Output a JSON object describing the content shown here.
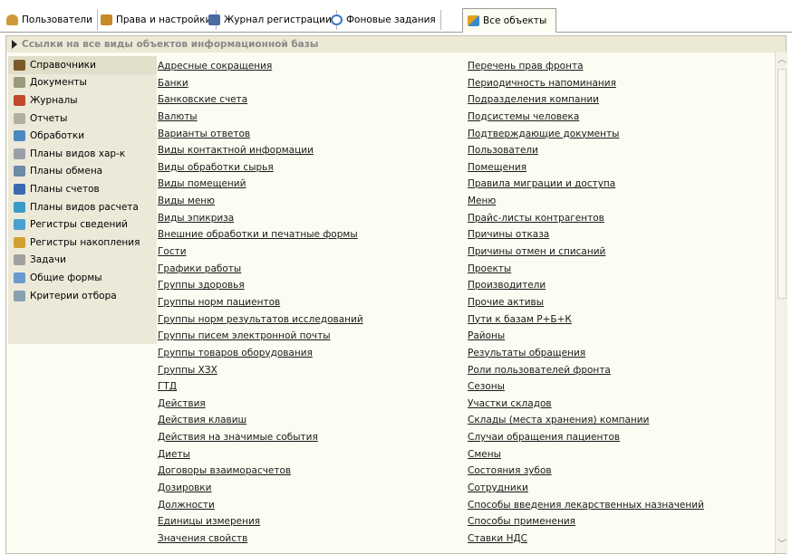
{
  "tabs": [
    {
      "label": "Пользователи",
      "icon": "users-icon",
      "color": "#d09a3a"
    },
    {
      "label": "Права и настройки",
      "icon": "permissions-icon",
      "color": "#c98a2a"
    },
    {
      "label": "Журнал регистрации",
      "icon": "log-icon",
      "color": "#4a6aa0"
    },
    {
      "label": "Фоновые задания",
      "icon": "clock-icon",
      "color": "#3a74c8"
    },
    {
      "label": "Все объекты",
      "icon": "objects-icon",
      "color": "#e3a21a"
    }
  ],
  "section": {
    "title": "Ссылки на все виды объектов информационной базы"
  },
  "sidebar": {
    "items": [
      {
        "label": "Справочники",
        "icon": "catalog-icon",
        "color": "#7a5a2a"
      },
      {
        "label": "Документы",
        "icon": "document-icon",
        "color": "#9a9a7a"
      },
      {
        "label": "Журналы",
        "icon": "journal-icon",
        "color": "#c04a2a"
      },
      {
        "label": "Отчеты",
        "icon": "report-icon",
        "color": "#b0b0a0"
      },
      {
        "label": "Обработки",
        "icon": "processing-icon",
        "color": "#4a8ac0"
      },
      {
        "label": "Планы видов хар-к",
        "icon": "chart-types-icon",
        "color": "#9aa0a8"
      },
      {
        "label": "Планы обмена",
        "icon": "exchange-icon",
        "color": "#6a8aa8"
      },
      {
        "label": "Планы счетов",
        "icon": "accounts-icon",
        "color": "#3a6ab0"
      },
      {
        "label": "Планы видов расчета",
        "icon": "calc-types-icon",
        "color": "#3a9ac8"
      },
      {
        "label": "Регистры сведений",
        "icon": "info-register-icon",
        "color": "#4aa0d0"
      },
      {
        "label": "Регистры накопления",
        "icon": "accum-register-icon",
        "color": "#d0a030"
      },
      {
        "label": "Задачи",
        "icon": "task-icon",
        "color": "#a0a0a0"
      },
      {
        "label": "Общие формы",
        "icon": "form-icon",
        "color": "#6a9ad0"
      },
      {
        "label": "Критерии отбора",
        "icon": "filter-icon",
        "color": "#8aa0b0"
      }
    ]
  },
  "links_col1": [
    "Адресные сокращения",
    "Банки",
    "Банковские счета",
    "Валюты",
    "Варианты ответов",
    "Виды контактной информации",
    "Виды обработки сырья",
    "Виды помещений",
    "Виды меню",
    "Виды эпикриза",
    "Внешние обработки и печатные формы",
    "Гости",
    "Графики работы",
    "Группы здоровья",
    "Группы норм пациентов",
    "Группы норм результатов исследований",
    "Группы писем электронной почты",
    "Группы товаров оборудования",
    "Группы ХЗХ",
    "ГТД",
    "Действия",
    "Действия клавиш",
    "Действия на значимые события",
    "Диеты",
    "Договоры взаиморасчетов",
    "Дозировки",
    "Должности",
    "Единицы измерения",
    "Значения свойств"
  ],
  "links_col2": [
    "Перечень прав фронта",
    "Периодичность напоминания",
    "Подразделения компании",
    "Подсистемы человека",
    "Подтверждающие документы",
    "Пользователи",
    "Помещения",
    "Правила миграции и доступа",
    "Меню",
    "Прайс-листы контрагентов",
    "Причины отказа",
    "Причины отмен и списаний",
    "Проекты",
    "Производители",
    "Прочие активы",
    "Пути к базам Р+Б+К",
    "Районы",
    "Результаты обращения",
    "Роли пользователей фронта",
    "Сезоны",
    "Участки складов",
    "Склады (места хранения) компании",
    "Случаи обращения пациентов",
    "Смены",
    "Состояния зубов",
    "Сотрудники",
    "Способы введения лекарственных назначений",
    "Способы применения",
    "Ставки НДС"
  ]
}
